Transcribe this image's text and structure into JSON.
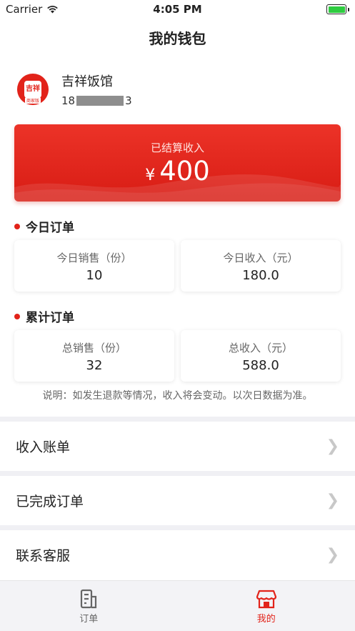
{
  "status_bar": {
    "carrier": "Carrier",
    "time": "4:05 PM"
  },
  "nav": {
    "title": "我的钱包"
  },
  "profile": {
    "name": "吉祥饭馆",
    "phone_prefix": "18",
    "phone_suffix": "3",
    "avatar_text": "吉祥",
    "avatar_tag": "商家版"
  },
  "income_card": {
    "label": "已结算收入",
    "currency": "¥",
    "value": "400"
  },
  "today": {
    "title": "今日订单",
    "sales_label": "今日销售（份）",
    "sales_value": "10",
    "income_label": "今日收入（元）",
    "income_value": "180.0"
  },
  "total": {
    "title": "累计订单",
    "sales_label": "总销售（份）",
    "sales_value": "32",
    "income_label": "总收入（元）",
    "income_value": "588.0"
  },
  "note": "说明：如发生退款等情况，收入将会变动。以次日数据为准。",
  "menu": [
    {
      "label": "收入账单"
    },
    {
      "label": "已完成订单"
    },
    {
      "label": "联系客服"
    }
  ],
  "tabs": [
    {
      "label": "订单",
      "icon": "orders-icon",
      "active": false
    },
    {
      "label": "我的",
      "icon": "shop-icon",
      "active": true
    }
  ],
  "colors": {
    "accent": "#e2231a",
    "battery": "#2ecc40"
  }
}
